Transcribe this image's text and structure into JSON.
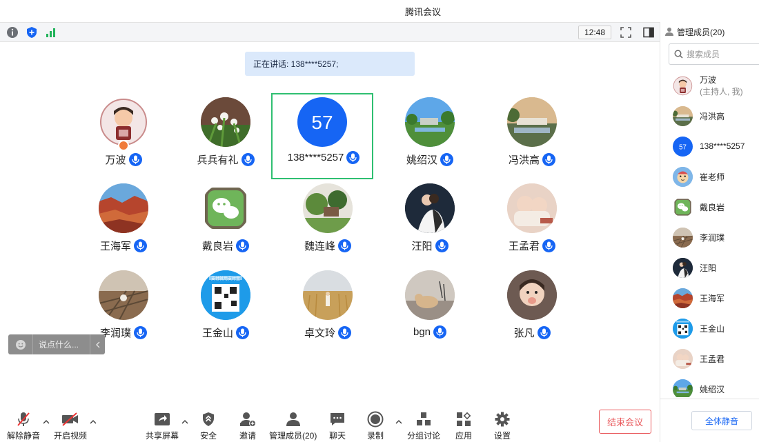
{
  "window": {
    "title": "腾讯会议"
  },
  "topbar": {
    "clock": "12:48"
  },
  "stage": {
    "speaking": "正在讲话: 138****5257;",
    "tiles": [
      {
        "name": "万波",
        "style": "host"
      },
      {
        "name": "兵兵有礼",
        "style": "flowers"
      },
      {
        "name": "138****5257",
        "style": "number",
        "number": "57",
        "active": true
      },
      {
        "name": "姚绍汉",
        "style": "landscape"
      },
      {
        "name": "冯洪高",
        "style": "landscape2"
      },
      {
        "name": "王海军",
        "style": "canyon"
      },
      {
        "name": "戴良岩",
        "style": "wechat"
      },
      {
        "name": "魏连峰",
        "style": "garden"
      },
      {
        "name": "汪阳",
        "style": "couple"
      },
      {
        "name": "王孟君",
        "style": "babies"
      },
      {
        "name": "李润璞",
        "style": "rails"
      },
      {
        "name": "王金山",
        "style": "qr",
        "qr_text": "支付就用支付宝"
      },
      {
        "name": "卓文玲",
        "style": "wheat"
      },
      {
        "name": "bgn",
        "style": "cat"
      },
      {
        "name": "张凡",
        "style": "child"
      }
    ],
    "chat_placeholder": "说点什么..."
  },
  "toolbar": {
    "unmute": "解除静音",
    "video": "开启视频",
    "share": "共享屏幕",
    "security": "安全",
    "invite": "邀请",
    "members": "管理成员(20)",
    "chat": "聊天",
    "record": "录制",
    "breakout": "分组讨论",
    "apps": "应用",
    "settings": "设置",
    "end": "结束会议"
  },
  "panel": {
    "header": "管理成员(20)",
    "search_placeholder": "搜索成员",
    "members": [
      {
        "name": "万波",
        "sub": "(主持人, 我)",
        "style": "host"
      },
      {
        "name": "冯洪高",
        "style": "landscape2"
      },
      {
        "name": "138****5257",
        "style": "number",
        "number": "57"
      },
      {
        "name": "崔老师",
        "style": "cartoon"
      },
      {
        "name": "戴良岩",
        "style": "wechat"
      },
      {
        "name": "李润璞",
        "style": "rails"
      },
      {
        "name": "汪阳",
        "style": "couple"
      },
      {
        "name": "王海军",
        "style": "canyon"
      },
      {
        "name": "王金山",
        "style": "qr"
      },
      {
        "name": "王孟君",
        "style": "babies"
      },
      {
        "name": "姚绍汉",
        "style": "landscape"
      }
    ],
    "mute_all": "全体静音"
  },
  "colors": {
    "accent": "#1665f4",
    "active_border": "#2fbf71",
    "end_red": "#e9575a"
  }
}
